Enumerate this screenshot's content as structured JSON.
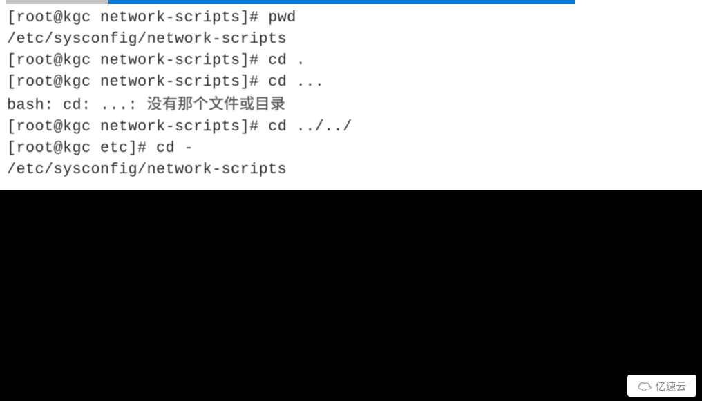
{
  "terminal": {
    "lines": [
      {
        "prompt": "[root@kgc network-scripts]# ",
        "cmd": "pwd"
      },
      {
        "output": "/etc/sysconfig/network-scripts"
      },
      {
        "prompt": "[root@kgc network-scripts]# ",
        "cmd": "cd ."
      },
      {
        "prompt": "[root@kgc network-scripts]# ",
        "cmd": "cd ..."
      },
      {
        "error_prefix": "bash: cd: ...: ",
        "error_cn": "没有那个文件或目录"
      },
      {
        "prompt": "[root@kgc network-scripts]# ",
        "cmd": "cd ../../"
      },
      {
        "prompt": "[root@kgc etc]# ",
        "cmd": "cd -"
      },
      {
        "output": "/etc/sysconfig/network-scripts"
      }
    ]
  },
  "watermark": {
    "text": "亿速云"
  }
}
